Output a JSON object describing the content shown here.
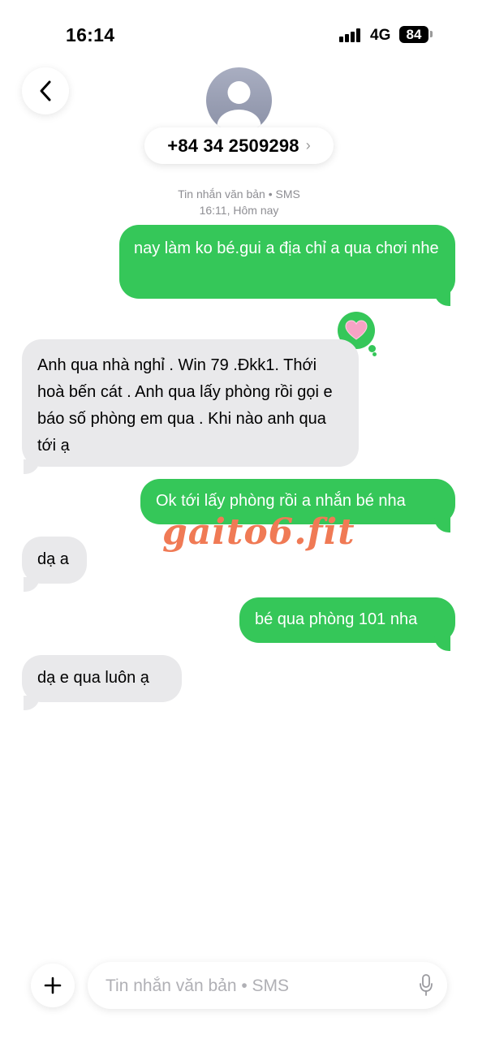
{
  "status_bar": {
    "time": "16:14",
    "network": "4G",
    "battery": "84"
  },
  "header": {
    "contact_number": "+84 34 2509298",
    "contact_chevron": "›"
  },
  "thread_meta": {
    "service": "Tin nhắn văn bản • SMS",
    "timestamp": "16:11, Hôm nay"
  },
  "messages": [
    {
      "direction": "outgoing",
      "text": "nay làm ko bé.gui a địa chỉ a qua chơi nhe"
    },
    {
      "direction": "incoming",
      "text": "Anh qua nhà nghỉ . Win 79 .Đkk1. Thới hoà bến cát . Anh qua lấy phòng rồi gọi e báo số phòng em qua . Khi nào anh qua tới ạ",
      "tapback": "heart"
    },
    {
      "direction": "outgoing",
      "text": "Ok tới lấy phòng rồi a nhắn bé nha"
    },
    {
      "direction": "incoming",
      "text": "dạ a"
    },
    {
      "direction": "outgoing",
      "text": "bé qua phòng 101 nha"
    },
    {
      "direction": "incoming",
      "text": "dạ e qua luôn ạ"
    }
  ],
  "watermark": "gaito6.fit",
  "composer": {
    "placeholder": "Tin nhắn văn bản • SMS"
  },
  "icons": {
    "back": "chevron-left-icon",
    "avatar": "person-silhouette-icon",
    "tapback": "pink-heart-icon",
    "add": "plus-icon",
    "mic": "microphone-icon"
  },
  "colors": {
    "outgoing_bubble": "#35c759",
    "incoming_bubble": "#e9e9eb",
    "watermark": "#f07a55"
  }
}
